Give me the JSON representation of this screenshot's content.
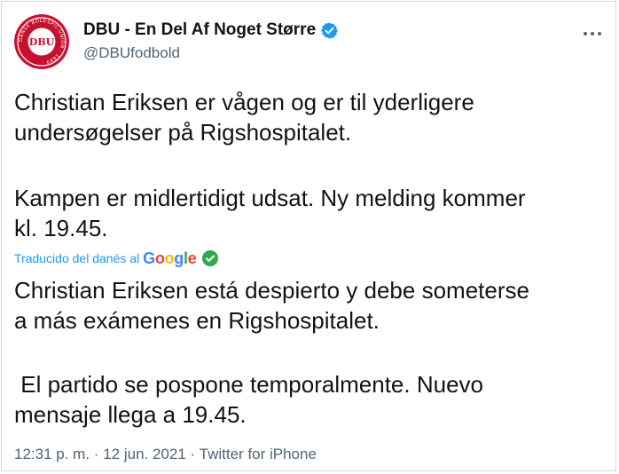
{
  "tweet": {
    "display_name": "DBU - En Del Af Noget Større",
    "handle": "@DBUfodbold",
    "avatar_text": "DBU",
    "avatar_ring_text": "DANSK BOLDSPIL-UNION · 1889 ·",
    "original_text": {
      "line1": "Christian Eriksen er vågen og er til yderligere",
      "line2": "undersøgelser på Rigshospitalet.",
      "line3": "Kampen er midlertidigt udsat. Ny melding kommer",
      "line4": "kl. 19.45."
    },
    "translation": {
      "label": "Traducido del danés al",
      "provider": "Google",
      "line1": "Christian Eriksen está despierto y debe someterse",
      "line2": "a más exámenes en Rigshospitalet.",
      "line3": " El partido se pospone temporalmente. Nuevo",
      "line4": "mensaje llega a 19.45."
    },
    "time": "12:31 p. m.",
    "date": "12 jun. 2021",
    "source": "Twitter for iPhone",
    "separator": "·"
  },
  "colors": {
    "text": "#0f1419",
    "secondary": "#536471",
    "link": "#1d9bf0",
    "verified": "#1d9bf0",
    "avatar_red": "#c8102e",
    "google_check": "#2fa84f"
  },
  "icons": {
    "verified": "verified-badge-icon",
    "more": "more-options-icon",
    "check": "check-circle-icon"
  }
}
